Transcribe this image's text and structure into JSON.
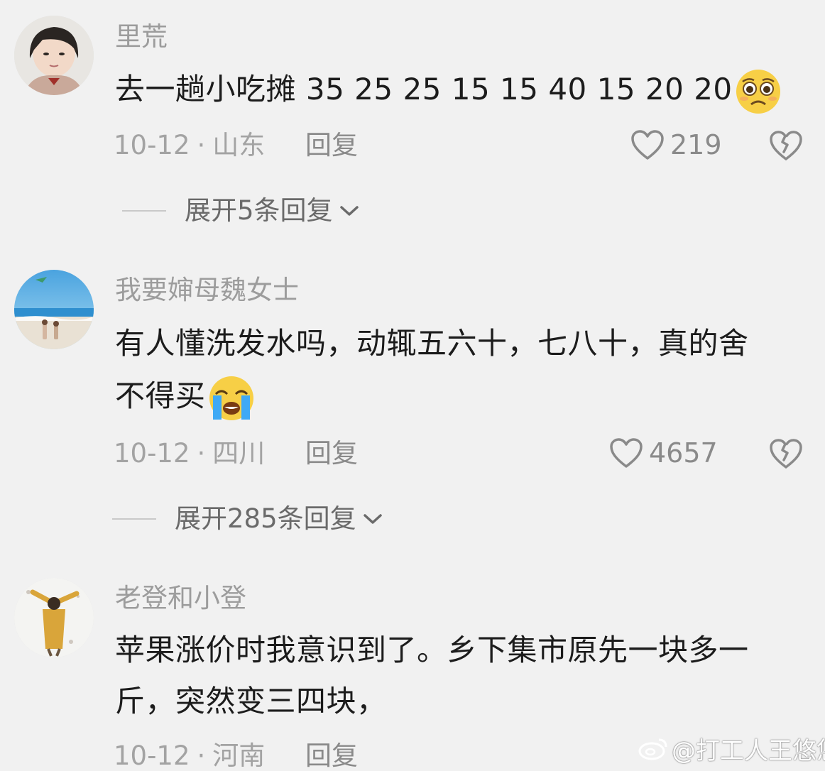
{
  "comments": [
    {
      "username": "里荒",
      "text": "去一趟小吃摊 35 25 25 15 15 40 15 20 20",
      "emoji": "pleading-face-emoji",
      "date": "10-12",
      "location": "山东",
      "reply_label": "回复",
      "likes": "219",
      "expand_label": "展开5条回复"
    },
    {
      "username": "我要婶母魏女士",
      "text_line1": "有人懂洗发水吗，动辄五六十，七八十，真的舍",
      "text_line2": "不得买",
      "emoji": "loudly-crying-face-emoji",
      "date": "10-12",
      "location": "四川",
      "reply_label": "回复",
      "likes": "4657",
      "expand_label": "展开285条回复"
    },
    {
      "username": "老登和小登",
      "text_line1": "苹果涨价时我意识到了。乡下集市原先一块多一",
      "text_line2": "斤，突然变三四块，",
      "date": "10-12",
      "location": "河南",
      "reply_label": "回复"
    }
  ],
  "separator": "·",
  "watermark": "@打工人王悠悠",
  "icons": {
    "like": "heart-outline-icon",
    "dislike": "broken-heart-icon",
    "expand": "chevron-down-icon"
  },
  "colors": {
    "background": "#f1f1f1",
    "text": "#1c1c1c",
    "meta": "#a3a3a3",
    "username": "#9c9c9c"
  }
}
